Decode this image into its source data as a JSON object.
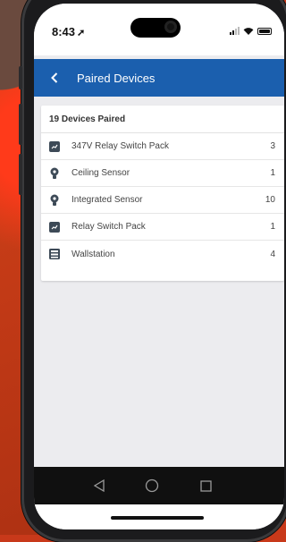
{
  "status_bar": {
    "time": "8:43",
    "location_arrow": "location-arrow-icon"
  },
  "app_bar": {
    "title": "Paired Devices",
    "back_icon": "chevron-left-icon"
  },
  "devices_card": {
    "header": "19 Devices Paired",
    "items": [
      {
        "label": "347V Relay Switch Pack",
        "count": "3",
        "icon": "relay-pack-icon"
      },
      {
        "label": "Ceiling Sensor",
        "count": "1",
        "icon": "bulb-sensor-icon"
      },
      {
        "label": "Integrated Sensor",
        "count": "10",
        "icon": "bulb-sensor-icon"
      },
      {
        "label": "Relay Switch Pack",
        "count": "1",
        "icon": "relay-pack-icon"
      },
      {
        "label": "Wallstation",
        "count": "4",
        "icon": "wallstation-icon"
      }
    ]
  },
  "colors": {
    "accent": "#1b5fae",
    "background_orange": "#c8391a"
  }
}
